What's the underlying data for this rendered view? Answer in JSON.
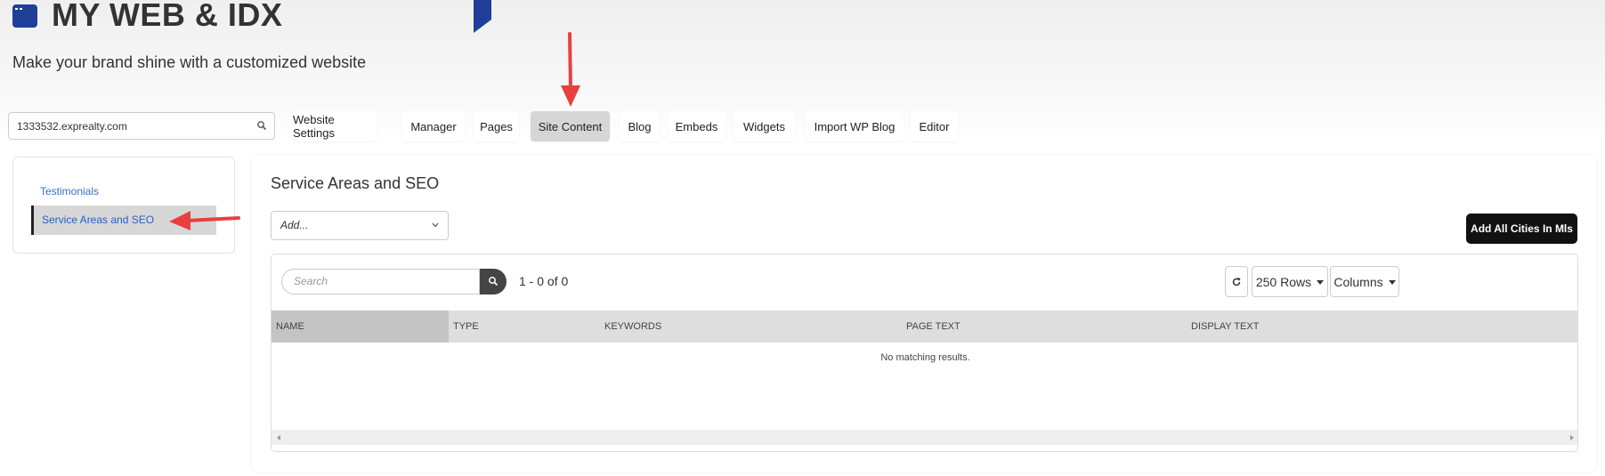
{
  "header": {
    "title": "MY WEB & IDX",
    "subtitle": "Make your brand shine with a customized website",
    "icon": "window-icon",
    "accent_color": "#1f3f99"
  },
  "domain": {
    "value": "1333532.exprealty.com"
  },
  "tabs": [
    {
      "label": "Website Settings",
      "active": false
    },
    {
      "label": "Manager",
      "active": false
    },
    {
      "label": "Pages",
      "active": false
    },
    {
      "label": "Site Content",
      "active": true
    },
    {
      "label": "Blog",
      "active": false
    },
    {
      "label": "Embeds",
      "active": false
    },
    {
      "label": "Widgets",
      "active": false
    },
    {
      "label": "Import WP Blog",
      "active": false
    },
    {
      "label": "Editor",
      "active": false
    }
  ],
  "sidebar": {
    "items": [
      {
        "label": "Testimonials",
        "active": false
      },
      {
        "label": "Service Areas and SEO",
        "active": true
      }
    ]
  },
  "main": {
    "title": "Service Areas and SEO",
    "add_select": "Add...",
    "add_all_button": "Add All Cities In Mls",
    "table": {
      "search_placeholder": "Search",
      "count_text": "1 - 0 of 0",
      "rows_button": "250 Rows",
      "columns_button": "Columns",
      "columns": [
        "NAME",
        "TYPE",
        "KEYWORDS",
        "PAGE TEXT",
        "DISPLAY TEXT"
      ],
      "empty_text": "No matching results."
    }
  },
  "annotation_color": "#e84040"
}
